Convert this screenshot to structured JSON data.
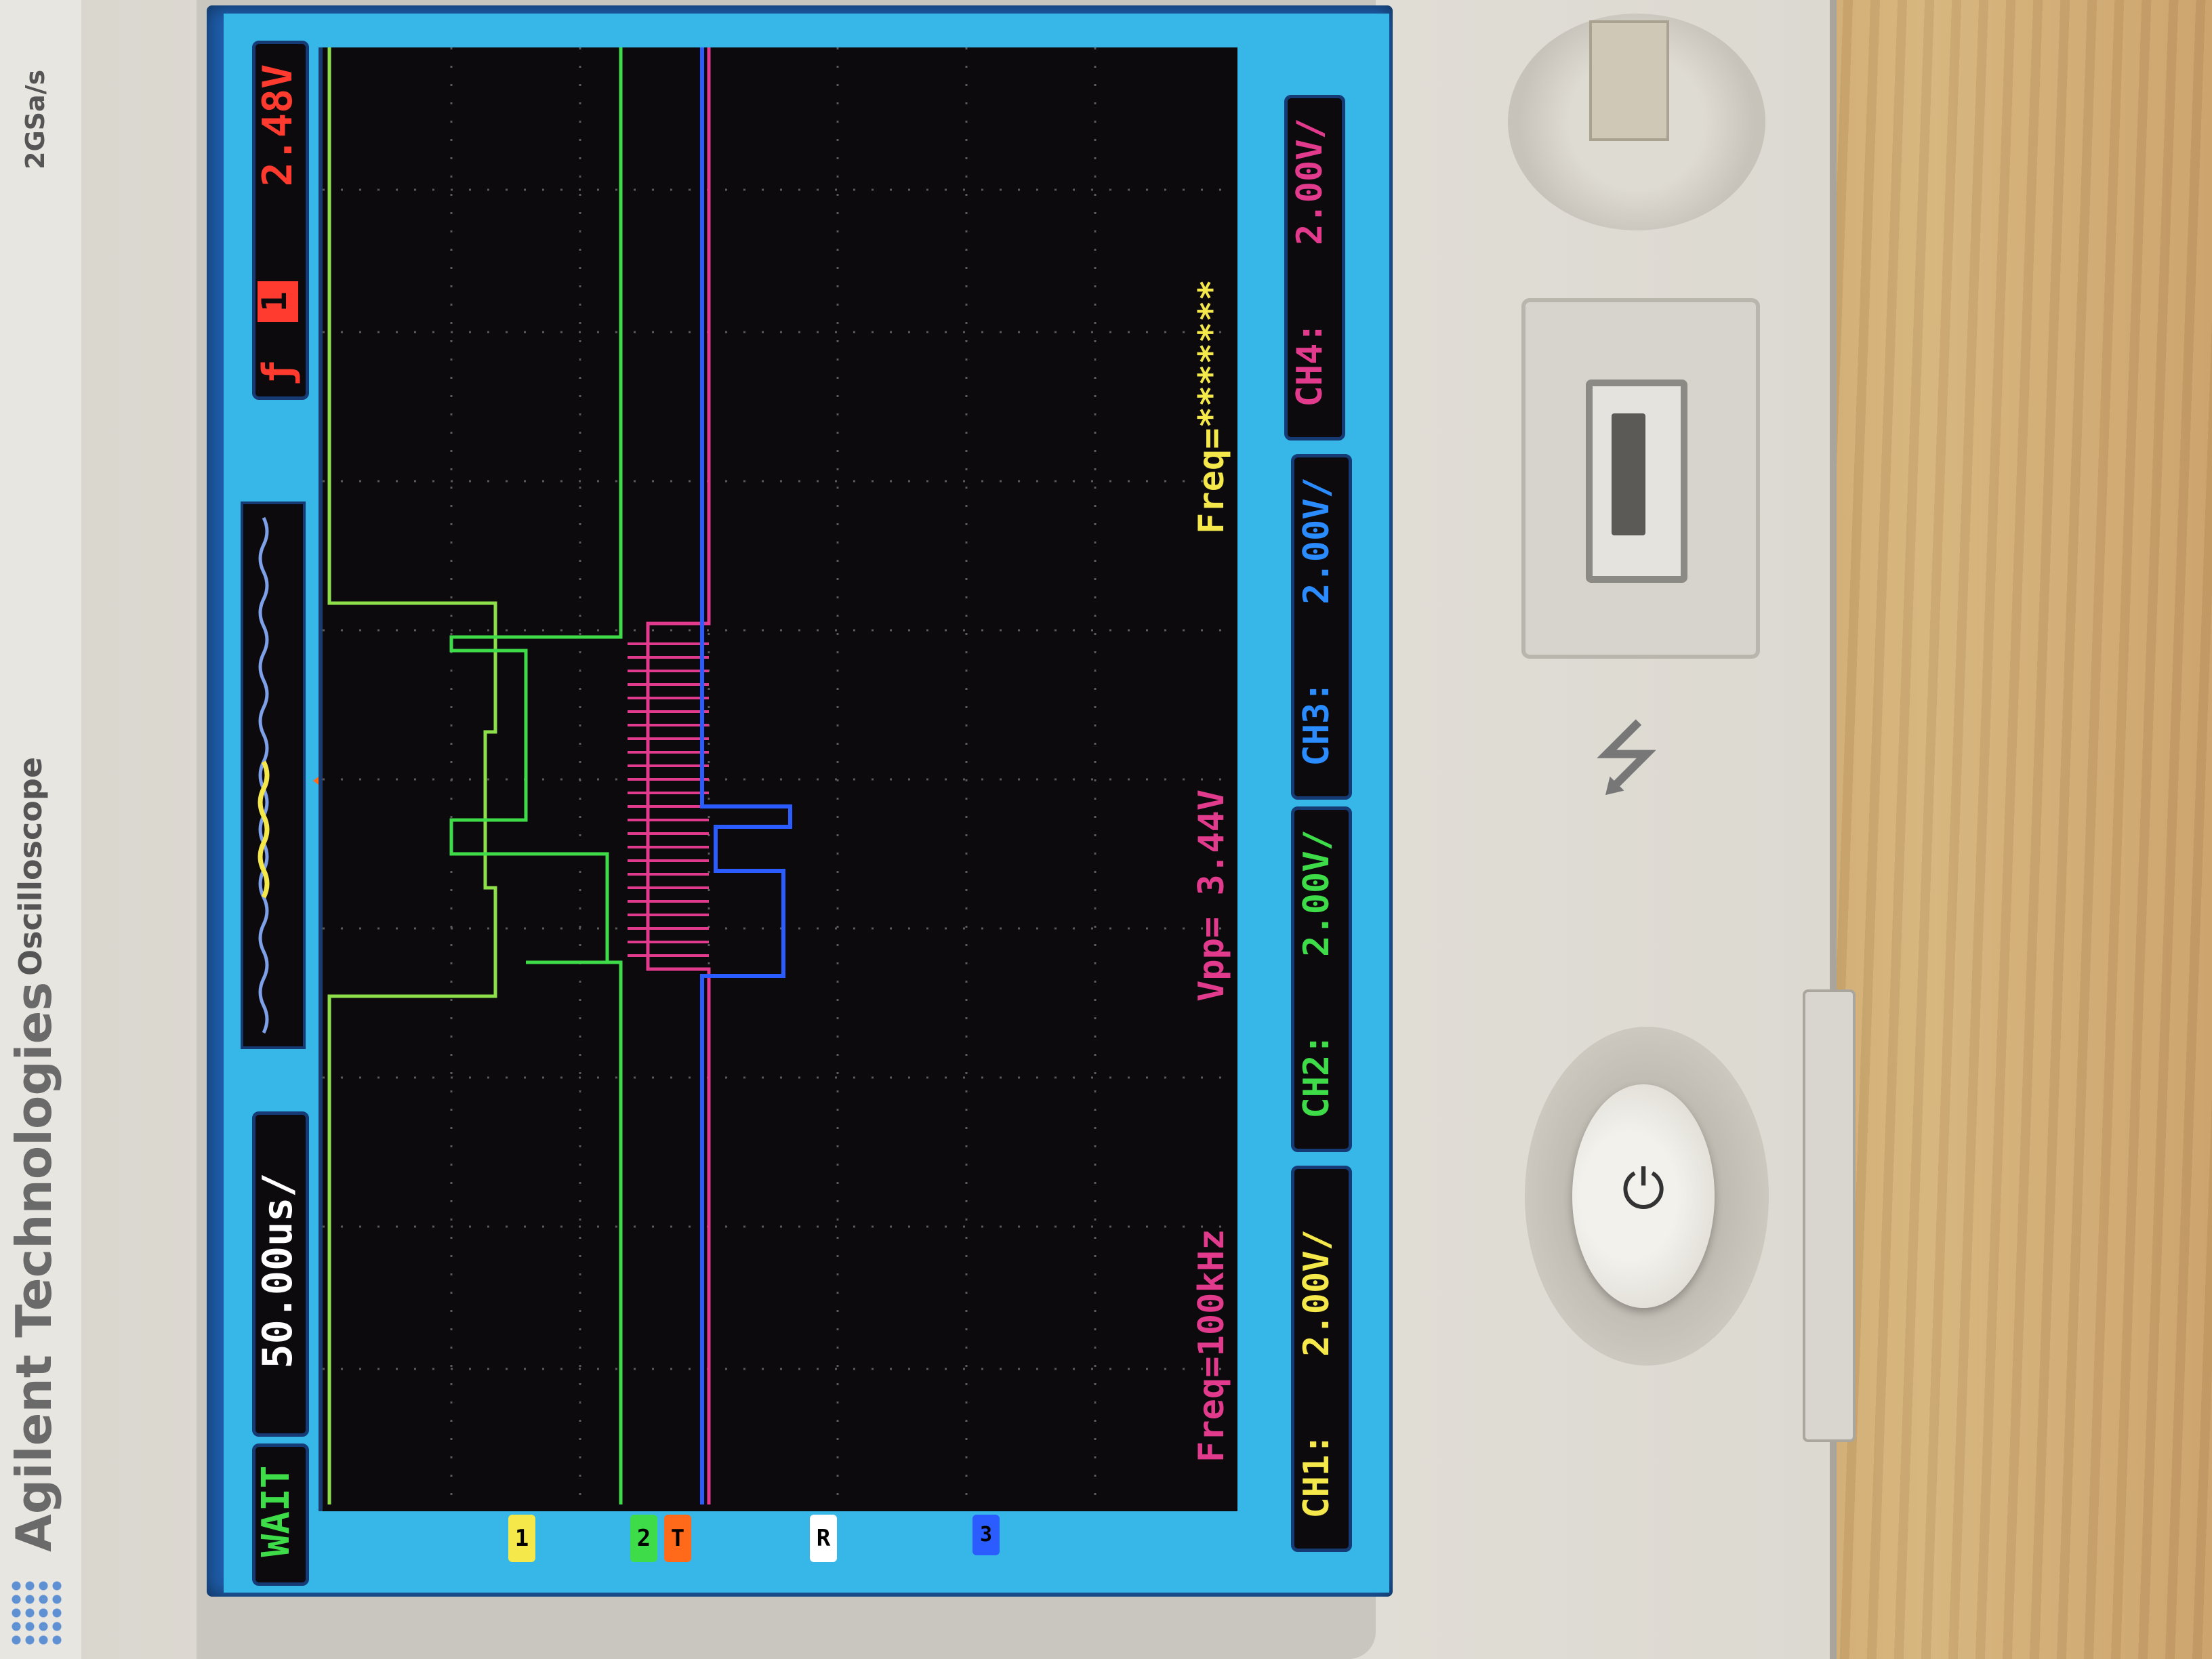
{
  "device": {
    "brand": "Agilent Technologies",
    "model": "Oscilloscope",
    "sample_rate": "2GSa/s"
  },
  "status_bar": {
    "run_state": "WAIT",
    "timebase": "50.00us/",
    "trigger_channel": "1",
    "trigger_level": "2.48V"
  },
  "measurements": {
    "freq1": "Freq=100kHz",
    "vpp": "Vpp= 3.44V",
    "freq2": "Freq=*******"
  },
  "channels": [
    {
      "label": "CH1:",
      "scale": "2.00V/",
      "color": "#f5e84a"
    },
    {
      "label": "CH2:",
      "scale": "2.00V/",
      "color": "#3fdc4a"
    },
    {
      "label": "CH3:",
      "scale": "2.00V/",
      "color": "#2a5cff"
    },
    {
      "label": "CH4:",
      "scale": "2.00V/",
      "color": "#e23a8c"
    }
  ],
  "markers": {
    "ch1": "1",
    "ch2": "2",
    "trigger": "T",
    "ref": "R",
    "ch3": "3"
  },
  "colors": {
    "screen_bg": "#36b7e8",
    "plot_bg": "#0c0a0c",
    "trace_green": "#3fdc4a",
    "trace_pink": "#e23a8c",
    "trace_blue": "#2a5cff",
    "label_magenta": "#e23a8c",
    "trigger_red": "#ff3b30"
  },
  "icons": {
    "usb": "usb-icon",
    "power": "power-icon"
  }
}
